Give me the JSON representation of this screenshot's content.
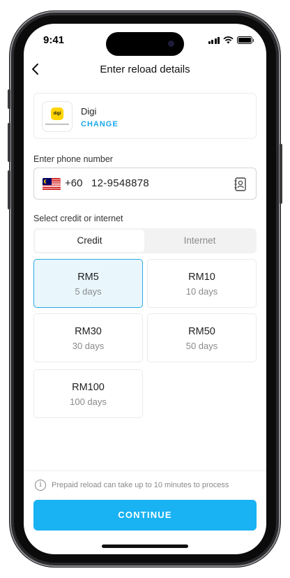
{
  "status_bar": {
    "time": "9:41"
  },
  "header": {
    "title": "Enter reload details"
  },
  "operator": {
    "name": "Digi",
    "change_label": "CHANGE",
    "logo_text": "digi"
  },
  "phone": {
    "label": "Enter phone number",
    "country_code": "+60",
    "number": "12-9548878"
  },
  "plan": {
    "label": "Select credit or internet",
    "tabs": [
      {
        "label": "Credit",
        "active": true
      },
      {
        "label": "Internet",
        "active": false
      }
    ]
  },
  "amounts": [
    {
      "value": "RM5",
      "validity": "5 days",
      "selected": true
    },
    {
      "value": "RM10",
      "validity": "10 days",
      "selected": false
    },
    {
      "value": "RM30",
      "validity": "30 days",
      "selected": false
    },
    {
      "value": "RM50",
      "validity": "50 days",
      "selected": false
    },
    {
      "value": "RM100",
      "validity": "100 days",
      "selected": false
    }
  ],
  "footer": {
    "info": "Prepaid reload can take up to 10 minutes to process",
    "continue_label": "CONTINUE"
  },
  "colors": {
    "accent": "#19b2f2",
    "selected_bg": "#e9f7fd",
    "brand_yellow": "#ffd400"
  }
}
